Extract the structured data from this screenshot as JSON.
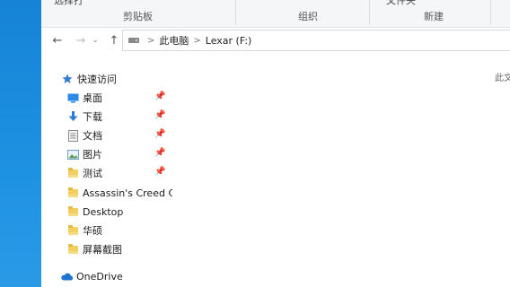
{
  "ribbon": {
    "top_cut_left": "选择打",
    "top_cut_right": "文件夹",
    "groups": [
      {
        "label": "剪贴板"
      },
      {
        "label": "组织"
      },
      {
        "label": "新建"
      }
    ]
  },
  "nav": {
    "back_icon": "←",
    "forward_icon": "→",
    "recent_icon": "⌄",
    "up_icon": "↑"
  },
  "address": {
    "crumbs": [
      "此电脑",
      "Lexar (F:)"
    ],
    "separator": ">"
  },
  "navpane": {
    "quick_access": {
      "label": "快速访问",
      "icon": "star-icon"
    },
    "pinned": [
      {
        "label": "桌面",
        "icon": "desktop-icon"
      },
      {
        "label": "下载",
        "icon": "download-icon"
      },
      {
        "label": "文档",
        "icon": "document-icon"
      },
      {
        "label": "图片",
        "icon": "pictures-icon"
      },
      {
        "label": "测试",
        "icon": "folder-icon"
      }
    ],
    "folders": [
      {
        "label": "Assassin's Creed  C"
      },
      {
        "label": "Desktop"
      },
      {
        "label": "华硕"
      },
      {
        "label": "屏幕截图"
      }
    ],
    "onedrive": {
      "label": "OneDrive",
      "icon": "cloud-icon"
    }
  },
  "content": {
    "hint_cut": "此文"
  },
  "colors": {
    "desktop_blue": "#1a8bdc",
    "folder_yellow": "#f3cf62",
    "accent": "#1e74d0"
  }
}
